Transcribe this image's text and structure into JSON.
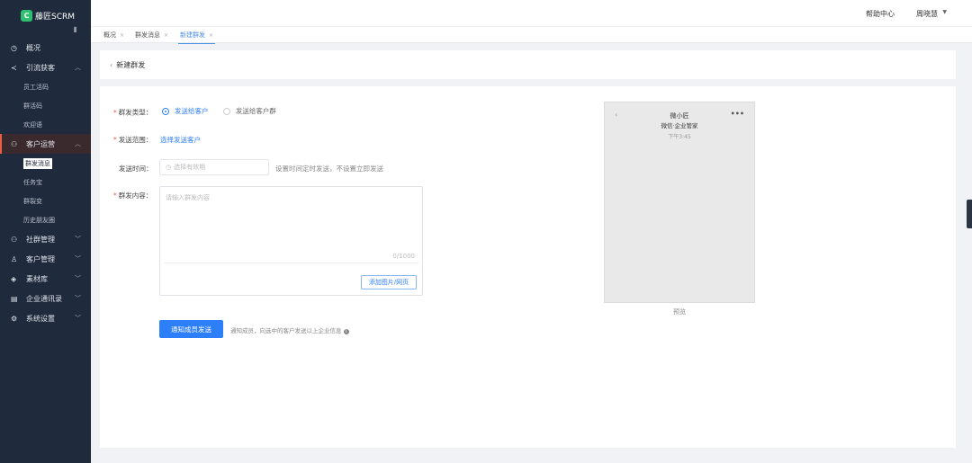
{
  "app": {
    "logo_letter": "C",
    "name": "藤匠SCRM"
  },
  "sidebar": {
    "menu": [
      {
        "label": "概况",
        "icon": "clock-icon"
      },
      {
        "label": "引流获客",
        "icon": "share-icon",
        "expanded": true,
        "children": [
          "员工活码",
          "群活码",
          "欢迎语"
        ]
      },
      {
        "label": "客户运营",
        "icon": "users-icon",
        "expanded": true,
        "active": true,
        "children": [
          "群发消息",
          "任务宝",
          "群裂变",
          "历史朋友圈"
        ],
        "selected_child": "群发消息"
      },
      {
        "label": "社群管理",
        "icon": "group-icon"
      },
      {
        "label": "客户管理",
        "icon": "user-icon"
      },
      {
        "label": "素材库",
        "icon": "layers-icon"
      },
      {
        "label": "企业通讯录",
        "icon": "book-icon"
      },
      {
        "label": "系统设置",
        "icon": "gear-icon"
      }
    ]
  },
  "topbar": {
    "help": "帮助中心",
    "user": "周晓慧"
  },
  "tabs": [
    {
      "label": "概况",
      "active": false
    },
    {
      "label": "群发消息",
      "active": false
    },
    {
      "label": "新建群发",
      "active": true
    }
  ],
  "page": {
    "back_title": "新建群发"
  },
  "form": {
    "type_label": "群发类型：",
    "type_options": [
      "发送给客户",
      "发送给客户群"
    ],
    "type_selected": "发送给客户",
    "scope_label": "发送范围：",
    "scope_link": "选择发送客户",
    "time_label": "发送时间：",
    "time_placeholder": "选择有效期",
    "time_hint": "设置时间定时发送，不设置立即发送",
    "content_label": "群发内容：",
    "content_placeholder": "请输入群发内容",
    "content_counter": "0/1000",
    "attach_button": "添加图片/网页",
    "submit_button": "通知成员发送",
    "submit_hint": "通知成员，向选中的客户发送以上企业信息"
  },
  "preview": {
    "name": "微小匠",
    "subtitle": "微信·企业管家",
    "time": "下午3:45",
    "label": "预览"
  },
  "colors": {
    "sidebar_bg": "#1f2a3c",
    "accent": "#2d7ff9",
    "active_marker": "#e8604c",
    "brand": "#2fbf71"
  }
}
